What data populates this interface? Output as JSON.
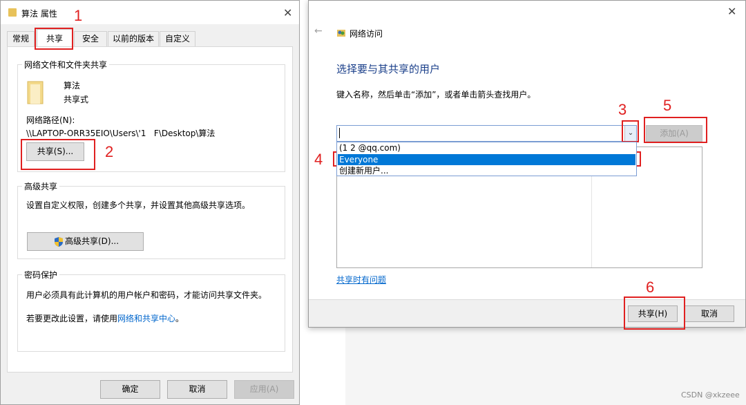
{
  "props_window": {
    "title": "算法 属性",
    "close_glyph": "✕",
    "tabs": [
      "常规",
      "共享",
      "安全",
      "以前的版本",
      "自定义"
    ],
    "network_group": {
      "title": "网络文件和文件夹共享",
      "folder_name": "算法",
      "folder_state": "共享式",
      "path_label": "网络路径(N):",
      "path_value": "\\\\LAPTOP-ORR35EIO\\Users\\'1   F\\Desktop\\算法",
      "share_button": "共享(S)..."
    },
    "advanced_group": {
      "title": "高级共享",
      "description": "设置自定义权限，创建多个共享，并设置其他高级共享选项。",
      "button": "高级共享(D)..."
    },
    "password_group": {
      "title": "密码保护",
      "line1": "用户必须具有此计算机的用户帐户和密码，才能访问共享文件夹。",
      "line2_prefix": "若要更改此设置，请使用",
      "line2_link": "网络和共享中心",
      "line2_suffix": "。"
    },
    "footer": {
      "ok": "确定",
      "cancel": "取消",
      "apply": "应用(A)"
    }
  },
  "share_dialog": {
    "close_glyph": "✕",
    "back_glyph": "←",
    "title": "网络访问",
    "heading": "选择要与其共享的用户",
    "instruction": "键入名称，然后单击“添加”，或者单击箭头查找用户。",
    "combo_value": "",
    "arrow_glyph": "⌄",
    "add_button": "添加(A)",
    "dropdown_items": [
      "  (1  2 @qq.com)",
      "Everyone",
      "创建新用户..."
    ],
    "problem_link": "共享时有问题",
    "share_button": "共享(H)",
    "cancel_button": "取消"
  },
  "annotations": [
    "1",
    "2",
    "3",
    "4",
    "5",
    "6"
  ],
  "watermark": "CSDN @xkzeee",
  "colors": {
    "annotation_red": "#e02020",
    "heading_blue": "#1a3f8a",
    "link_blue": "#0066cc",
    "selection": "#0078d7"
  }
}
